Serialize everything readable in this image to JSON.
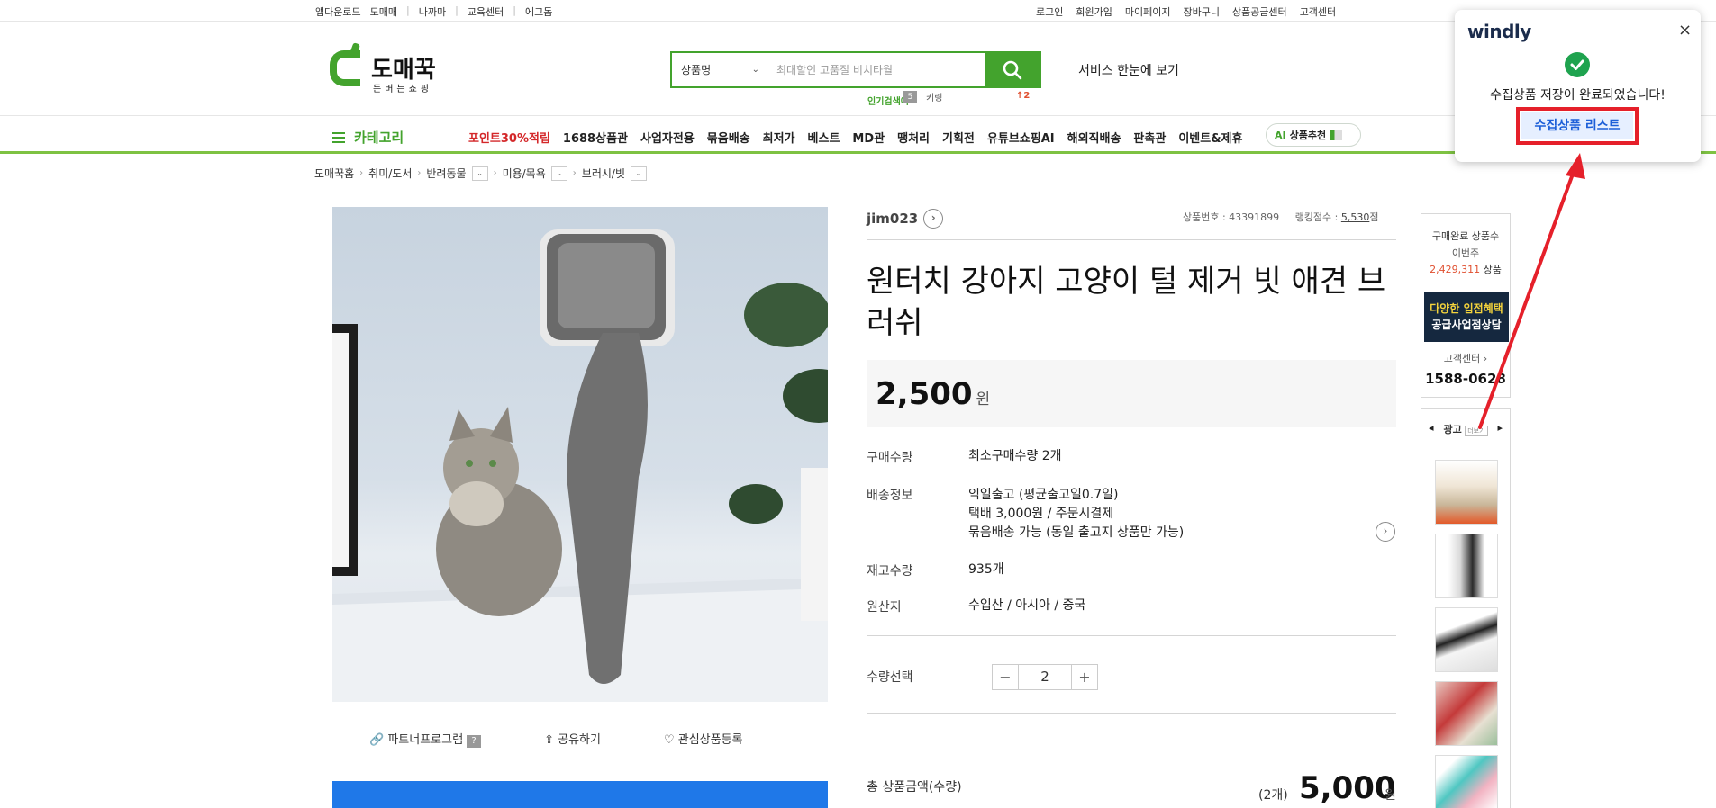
{
  "topbar": {
    "left_links": [
      "앱다운로드",
      "도매매",
      "나까마",
      "교육센터",
      "에그돔"
    ],
    "right_links": [
      "로그인",
      "회원가입",
      "마이페이지",
      "장바구니",
      "상품공급센터",
      "고객센터"
    ]
  },
  "header": {
    "logo_title": "도매꾹",
    "logo_sub": "돈버는쇼핑",
    "search_type": "상품명",
    "search_placeholder": "최대할인 고품질 비치타월",
    "service_link": "서비스 한눈에 보기",
    "popular_label": "인기검색어",
    "popular_rank": "5",
    "popular_word": "키링",
    "popular_change": "↑2"
  },
  "nav": {
    "category": "카테고리",
    "items": [
      "포인트30%적립",
      "1688상품관",
      "사업자전용",
      "묶음배송",
      "최저가",
      "베스트",
      "MD관",
      "땡처리",
      "기획전",
      "유튜브쇼핑AI",
      "해외직배송",
      "판촉관",
      "이벤트&제휴"
    ],
    "ai_pill": "상품추천",
    "ai_label": "AI"
  },
  "breadcrumb": [
    "도매꾹홈",
    "취미/도서",
    "반려동물",
    "미용/목욕",
    "브러시/빗"
  ],
  "image_actions": {
    "partner": "파트너프로그램",
    "share": "공유하기",
    "wish": "관심상품등록"
  },
  "product": {
    "seller": "jim023",
    "product_no": "상품번호 : 43391899",
    "ranking_label": "랭킹점수 : ",
    "ranking_value": "5,530",
    "ranking_unit": "점",
    "title": "원터치 강아지 고양이 털 제거 빗 애견 브러쉬",
    "price": "2,500",
    "won": "원",
    "rows": {
      "min_qty_label": "구매수량",
      "min_qty_value": "최소구매수량 2개",
      "ship_label": "배송정보",
      "ship_line1": "익일출고 (평균출고일0.7일)",
      "ship_line2": "택배 3,000원 / 주문시결제",
      "ship_line3": "묶음배송 가능 (동일 출고지 상품만 가능)",
      "stock_label": "재고수량",
      "stock_value": "935개",
      "origin_label": "원산지",
      "origin_value": "수입산 / 아시아 / 중국",
      "qty_label": "수량선택",
      "qty_value": "2"
    },
    "total_label": "총 상품금액(수량)",
    "total_count": "(2개)",
    "total_price": "5,000",
    "total_won": "원"
  },
  "sidebar": {
    "line1": "구매완료 상품수",
    "line2": "이번주",
    "count": "2,429,311",
    "count_unit": " 상품",
    "banner_line1": "다양한 입점혜택",
    "banner_line2": "공급사업점상담",
    "cs_label": "고객센터",
    "cs_phone": "1588-0628",
    "ad_label": "광고",
    "ad_tag": "더보기"
  },
  "popup": {
    "brand": "windly",
    "close": "×",
    "message": "수집상품 저장이 완료되었습니다!",
    "button": "수집상품 리스트"
  },
  "colors": {
    "brand_green": "#43a32d",
    "highlight_red": "#e5202a",
    "popup_link": "#1d5fd8"
  }
}
